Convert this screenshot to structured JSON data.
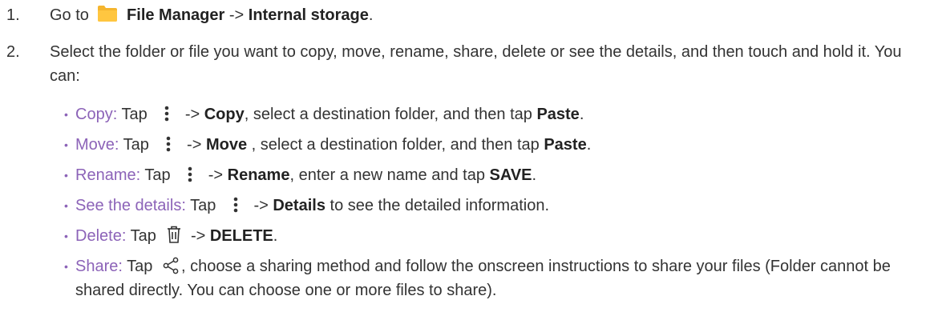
{
  "steps": [
    {
      "num": "1.",
      "prefix": "Go to",
      "app": "File Manager",
      "arrow": "->",
      "target": "Internal storage",
      "end": "."
    },
    {
      "num": "2.",
      "text": "Select the folder or file you want to copy, move, rename, share, delete or see the details, and then touch and hold it. You can:"
    }
  ],
  "bullets": [
    {
      "label": "Copy:",
      "pre": "Tap",
      "icon": "more-vertical-icon",
      "arrow": "->",
      "action": "Copy",
      "mid": ", select a destination folder, and then tap",
      "action2": "Paste",
      "end": "."
    },
    {
      "label": "Move:",
      "pre": "Tap",
      "icon": "more-vertical-icon",
      "arrow": "->",
      "action": "Move",
      "mid": " , select a destination folder, and then tap",
      "action2": "Paste",
      "end": "."
    },
    {
      "label": "Rename:",
      "pre": "Tap",
      "icon": "more-vertical-icon",
      "arrow": "->",
      "action": "Rename",
      "mid": ", enter a new name and tap",
      "action2": "SAVE",
      "end": "."
    },
    {
      "label": "See the details:",
      "pre": "Tap",
      "icon": "more-vertical-icon",
      "arrow": "->",
      "action": "Details",
      "mid": "to see the detailed information.",
      "end": ""
    },
    {
      "label": "Delete:",
      "pre": "Tap",
      "icon": "trash-icon",
      "arrow": "->",
      "action": "DELETE",
      "end": "."
    },
    {
      "label": "Share:",
      "pre": "Tap",
      "icon": "share-icon",
      "text": ", choose a sharing method and follow the onscreen instructions to share your files (Folder cannot be shared directly. You can choose one or more files to share)."
    }
  ],
  "colors": {
    "label": "#8c63b8",
    "text": "#333333",
    "folder": "#f5b52e"
  }
}
